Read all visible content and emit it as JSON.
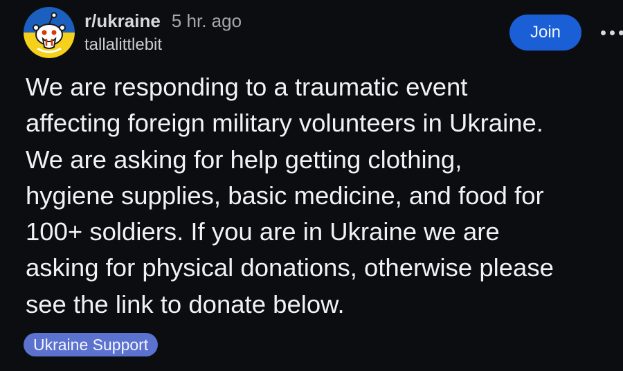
{
  "post": {
    "subreddit": "r/ukraine",
    "timestamp": "5 hr. ago",
    "author": "tallalittlebit",
    "join_label": "Join",
    "title_lines": [
      "We are responding to a traumatic event",
      "affecting foreign military volunteers in Ukraine.",
      "We are asking for help getting clothing,",
      "hygiene supplies, basic medicine, and food for",
      "100+ soldiers. If you are in Ukraine we are",
      "asking for physical donations, otherwise please",
      "see the link to donate below."
    ],
    "flair": "Ukraine Support"
  },
  "colors": {
    "background": "#0b0d10",
    "join_button": "#1a5fd6",
    "flair": "#5b72cf",
    "avatar_blue": "#1b5fbf",
    "avatar_yellow": "#f5d11b"
  },
  "icons": {
    "avatar": "subreddit-avatar-icon",
    "more": "more-options-icon"
  }
}
